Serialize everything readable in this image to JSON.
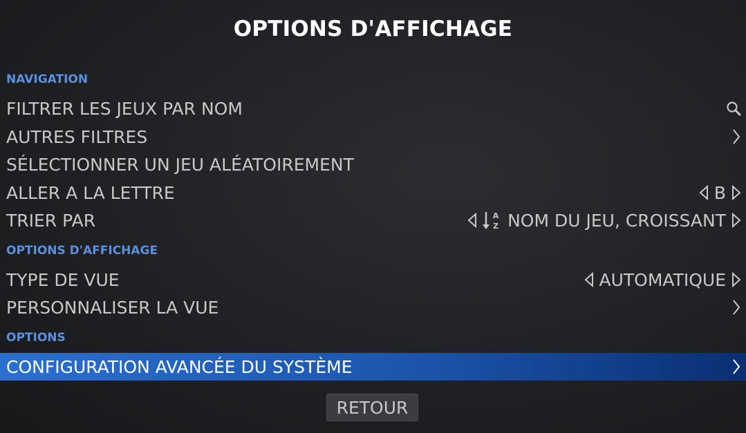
{
  "title": "OPTIONS D'AFFICHAGE",
  "sections": {
    "navigation": "NAVIGATION",
    "display": "OPTIONS D'AFFICHAGE",
    "options": "OPTIONS"
  },
  "rows": {
    "filter_by_name": {
      "label": "FILTRER LES JEUX PAR NOM",
      "icon": "search-icon"
    },
    "other_filters": {
      "label": "AUTRES FILTRES",
      "icon": "chevron-right-icon"
    },
    "random_game": {
      "label": "SÉLECTIONNER UN JEU ALÉATOIREMENT"
    },
    "go_to_letter": {
      "label": "ALLER A LA LETTRE",
      "value": "B",
      "icons": [
        "triangle-left-icon",
        "triangle-right-icon"
      ]
    },
    "sort_by": {
      "label": "TRIER PAR",
      "value": "NOM DU JEU, CROISSANT",
      "icons": [
        "triangle-left-icon",
        "sort-az-icon",
        "triangle-right-icon"
      ]
    },
    "view_type": {
      "label": "TYPE DE VUE",
      "value": "AUTOMATIQUE",
      "icons": [
        "triangle-left-icon",
        "triangle-right-icon"
      ]
    },
    "customize_view": {
      "label": "PERSONNALISER LA VUE",
      "icon": "chevron-right-icon"
    },
    "advanced_config": {
      "label": "CONFIGURATION AVANCÉE DU SYSTÈME",
      "icon": "chevron-right-icon",
      "selected": true
    }
  },
  "back_button": "RETOUR",
  "colors": {
    "section_header": "#5b8fe0",
    "selected_row_start": "#2a6fd0",
    "selected_row_end": "#0a2f72",
    "text": "#c8c8c8"
  }
}
